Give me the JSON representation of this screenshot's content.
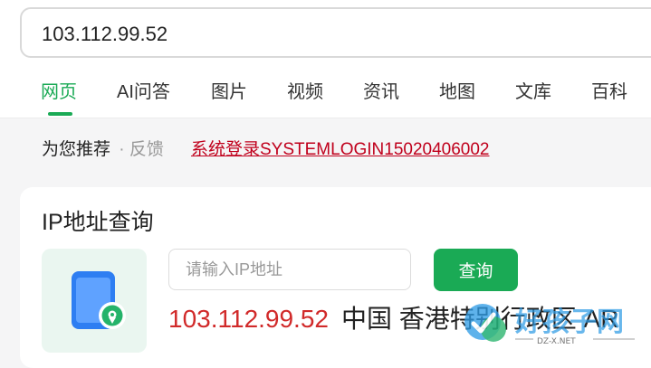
{
  "search": {
    "query": "103.112.99.52"
  },
  "tabs": [
    {
      "label": "网页",
      "active": true
    },
    {
      "label": "AI问答"
    },
    {
      "label": "图片"
    },
    {
      "label": "视频"
    },
    {
      "label": "资讯"
    },
    {
      "label": "地图"
    },
    {
      "label": "文库"
    },
    {
      "label": "百科"
    }
  ],
  "recommend": {
    "prefix": "为您推荐",
    "separator": "·",
    "feedback": "反馈",
    "link": "系统登录SYSTEMLOGIN15020406002"
  },
  "ip_card": {
    "title": "IP地址查询",
    "input_placeholder": "请输入IP地址",
    "button_label": "查询",
    "result_ip": "103.112.99.52",
    "result_location": "中国 香港特别行政区 AR",
    "icon": "phone-location-icon"
  },
  "watermark": {
    "text": "好孩子网",
    "subtext": "DZ-X.NET"
  },
  "colors": {
    "accent": "#1aaa55",
    "link": "#c0001c",
    "result_ip": "#d12a2a"
  }
}
